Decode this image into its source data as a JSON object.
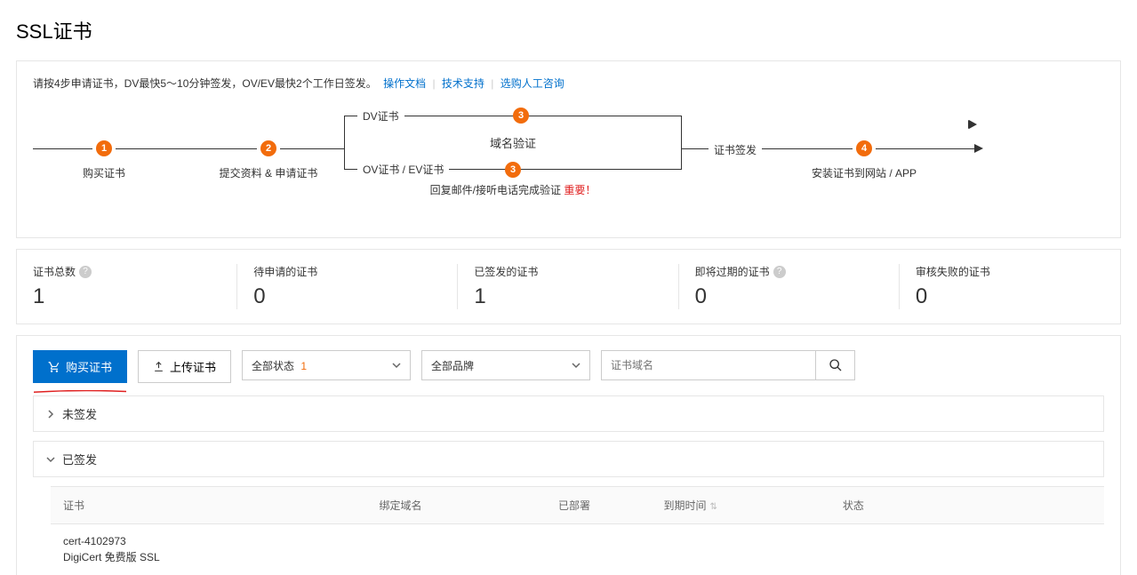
{
  "page_title": "SSL证书",
  "info": {
    "text": "请按4步申请证书，DV最快5～10分钟签发，OV/EV最快2个工作日签发。",
    "link_doc": "操作文档",
    "link_support": "技术支持",
    "link_consult": "选购人工咨询"
  },
  "flow": {
    "step1": "购买证书",
    "step2": "提交资料 & 申请证书",
    "dv_label": "DV证书",
    "ov_label": "OV证书 / EV证书",
    "mid_title": "域名验证",
    "bot_text": "回复邮件/接听电话完成验证",
    "bot_warn": "重要！",
    "link_text": "证书签发",
    "step4": "安装证书到网站 / APP",
    "b1": "1",
    "b2": "2",
    "b3a": "3",
    "b3b": "3",
    "b4": "4"
  },
  "stats": [
    {
      "label": "证书总数",
      "help": true,
      "value": "1"
    },
    {
      "label": "待申请的证书",
      "help": false,
      "value": "0"
    },
    {
      "label": "已签发的证书",
      "help": false,
      "value": "1"
    },
    {
      "label": "即将过期的证书",
      "help": true,
      "value": "0"
    },
    {
      "label": "审核失败的证书",
      "help": false,
      "value": "0"
    }
  ],
  "toolbar": {
    "buy": "购买证书",
    "upload": "上传证书",
    "status_filter": "全部状态",
    "status_count": "1",
    "brand_filter": "全部品牌",
    "search_placeholder": "证书域名"
  },
  "groups": {
    "unsigned": "未签发",
    "signed": "已签发"
  },
  "cols": {
    "cert": "证书",
    "domain": "绑定域名",
    "deployed": "已部署",
    "expiry": "到期时间",
    "status": "状态"
  },
  "rows": [
    {
      "id": "cert-4102973",
      "type": "DigiCert 免费版 SSL",
      "domain": "",
      "deployed": "",
      "expiry": "",
      "status": ""
    }
  ],
  "help_glyph": "?"
}
